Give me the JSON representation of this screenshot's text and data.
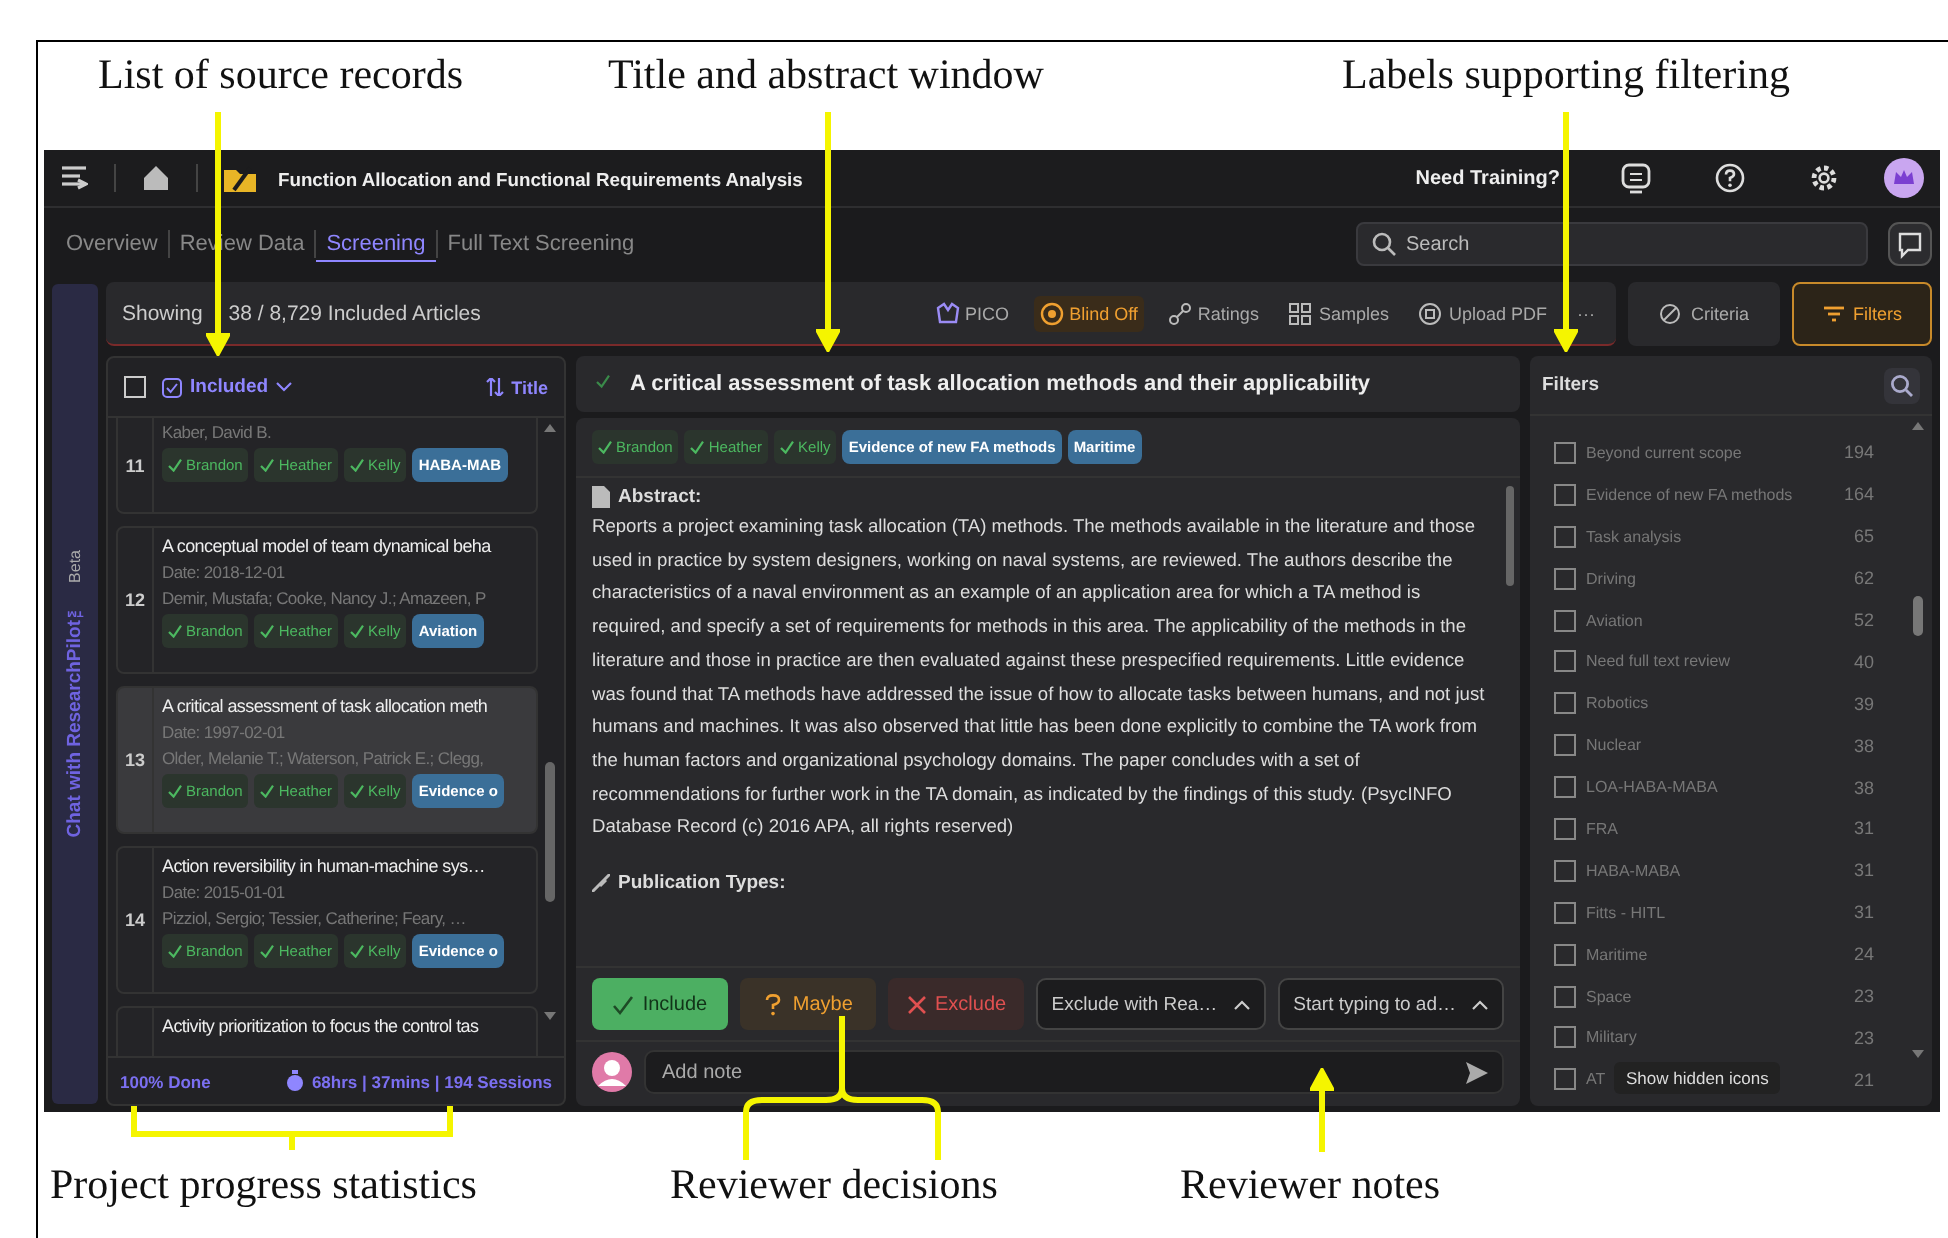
{
  "annotations_top": [
    {
      "text": "List of source records",
      "kind": "arrow"
    },
    {
      "text": "Title and abstract window",
      "kind": "arrow"
    },
    {
      "text": "Labels supporting filtering",
      "kind": "arrow"
    }
  ],
  "annotations_bottom": [
    {
      "text": "Project progress statistics",
      "kind": "bracket"
    },
    {
      "text": "Reviewer decisions",
      "kind": "bracket"
    },
    {
      "text": "Reviewer notes",
      "kind": "arrow"
    }
  ],
  "header": {
    "project_title": "Function Allocation and Functional Requirements Analysis",
    "training": "Need Training?"
  },
  "tabs": [
    {
      "label": "Overview",
      "selected": false
    },
    {
      "label": "Review Data",
      "selected": false
    },
    {
      "label": "Screening",
      "selected": true
    },
    {
      "label": "Full Text Screening",
      "selected": false
    }
  ],
  "search": {
    "placeholder": "Search"
  },
  "toolbar": {
    "showing": "Showing",
    "count": "38 / 8,729 Included Articles",
    "actions": [
      {
        "label": "PICO",
        "active": false
      },
      {
        "label": "Blind Off",
        "active": true
      },
      {
        "label": "Ratings",
        "active": false
      },
      {
        "label": "Samples",
        "active": false
      },
      {
        "label": "Upload PDF",
        "active": false
      },
      {
        "label": "···",
        "active": false
      }
    ],
    "criteria": {
      "label": "Criteria",
      "active": false
    },
    "filters": {
      "label": "Filters",
      "active": true
    }
  },
  "chat_sidebar": {
    "label": "Chat with ResearchPilot™",
    "badge": "Beta"
  },
  "list": {
    "all_checked": false,
    "filter": "Included",
    "sort": "Title",
    "records": [
      {
        "number": "11",
        "authors": "Kaber, David B.",
        "reviewers": [
          "Brandon",
          "Heather",
          "Kelly"
        ],
        "tags": [
          "HABA-MAB"
        ],
        "selected": false
      },
      {
        "number": "12",
        "title": "A conceptual model of team dynamical beha",
        "date": "Date: 2018-12-01",
        "authors": "Demir, Mustafa; Cooke, Nancy J.; Amazeen, P",
        "reviewers": [
          "Brandon",
          "Heather",
          "Kelly"
        ],
        "tags": [
          "Aviation"
        ],
        "selected": false
      },
      {
        "number": "13",
        "title": "A critical assessment of task allocation meth",
        "date": "Date: 1997-02-01",
        "authors": "Older, Melanie T.; Waterson, Patrick E.; Clegg,",
        "reviewers": [
          "Brandon",
          "Heather",
          "Kelly"
        ],
        "tags": [
          "Evidence o"
        ],
        "selected": true
      },
      {
        "number": "14",
        "title": "Action reversibility in human-machine sys…",
        "date": "Date: 2015-01-01",
        "authors": "Pizziol, Sergio; Tessier, Catherine; Feary, …",
        "reviewers": [
          "Brandon",
          "Heather",
          "Kelly"
        ],
        "tags": [
          "Evidence o"
        ],
        "selected": false
      },
      {
        "title": "Activity prioritization to focus the control tas",
        "selected": false
      }
    ],
    "done": "100% Done",
    "stats": "68hrs | 37mins | 194 Sessions"
  },
  "detail": {
    "title": "A critical assessment of task allocation methods and their applicability",
    "reviewers": [
      "Brandon",
      "Heather",
      "Kelly"
    ],
    "tags": [
      "Evidence of new FA methods",
      "Maritime"
    ],
    "abstract_heading": "Abstract:",
    "abstract": "Reports a project examining task allocation (TA) methods. The methods available in the literature and those used in practice by system designers, working on naval systems, are reviewed. The authors describe the characteristics of a naval environment as an example of an application area for which a TA method is required, and specify a set of requirements for methods in this area. The applicability of the methods in the literature and those in practice are then evaluated against these prespecified requirements. Little evidence was found that TA methods have addressed the issue of how to allocate tasks between humans, and not just humans and machines. It was also observed that little has been done explicitly to combine the TA work from the human factors and organizational psychology domains. The paper concludes with a set of recommendations for further work in the TA domain, as indicated by the findings of this study. (PsycINFO Database Record (c) 2016 APA, all rights reserved)",
    "publication_heading": "Publication Types:",
    "decisions": [
      {
        "label": "Include",
        "kind": "include",
        "selected": true
      },
      {
        "label": "Maybe",
        "kind": "maybe",
        "selected": false
      },
      {
        "label": "Exclude",
        "kind": "exclude",
        "selected": false
      }
    ],
    "dropdowns": [
      "Exclude with Rea…",
      "Start typing to ad…"
    ],
    "note_placeholder": "Add note"
  },
  "filters": {
    "title": "Filters",
    "tooltip": "Show hidden icons",
    "items": [
      {
        "label": "Beyond current scope",
        "count": "194",
        "checked": false
      },
      {
        "label": "Evidence of new FA methods",
        "count": "164",
        "checked": false
      },
      {
        "label": "Task analysis",
        "count": "65",
        "checked": false
      },
      {
        "label": "Driving",
        "count": "62",
        "checked": false
      },
      {
        "label": "Aviation",
        "count": "52",
        "checked": false
      },
      {
        "label": "Need full text review",
        "count": "40",
        "checked": false
      },
      {
        "label": "Robotics",
        "count": "39",
        "checked": false
      },
      {
        "label": "Nuclear",
        "count": "38",
        "checked": false
      },
      {
        "label": "LOA-HABA-MABA",
        "count": "38",
        "checked": false
      },
      {
        "label": "FRA",
        "count": "31",
        "checked": false
      },
      {
        "label": "HABA-MABA",
        "count": "31",
        "checked": false
      },
      {
        "label": "Fitts - HITL",
        "count": "31",
        "checked": false
      },
      {
        "label": "Maritime",
        "count": "24",
        "checked": false
      },
      {
        "label": "Space",
        "count": "23",
        "checked": false
      },
      {
        "label": "Military",
        "count": "23",
        "checked": false
      },
      {
        "label": "AT",
        "count": "21",
        "checked": false
      }
    ]
  }
}
